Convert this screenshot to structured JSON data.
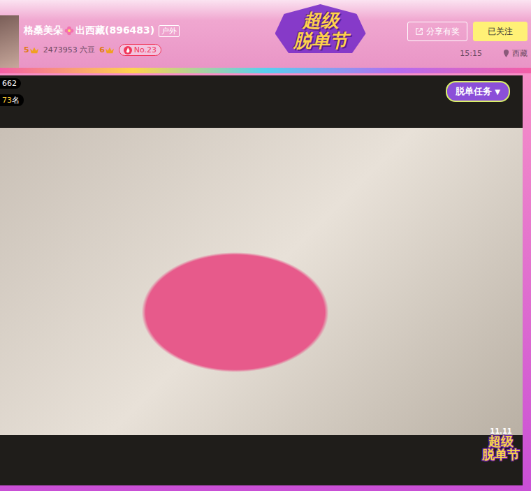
{
  "header": {
    "streamer": {
      "name": "格桑美朵",
      "title": "出西藏(896483)",
      "category": "户外"
    },
    "stats": {
      "level": "5",
      "beans": "2473953 六豆",
      "wealth_level": "6",
      "rank": "No.23"
    },
    "festival_logo": [
      "超级",
      "脱单节"
    ],
    "buttons": [
      {
        "label": "分享有奖",
        "selected": false
      },
      {
        "label": "已关注",
        "selected": true
      }
    ],
    "time": "15:15",
    "location": "西藏"
  },
  "player": {
    "viewers": "662",
    "rank_number": "73",
    "rank_suffix": "名",
    "task_button": "脱单任务",
    "task_arrow": "▼",
    "corner_logo": {
      "date": "11.11",
      "lines": [
        "超级",
        "脱单节"
      ]
    }
  }
}
